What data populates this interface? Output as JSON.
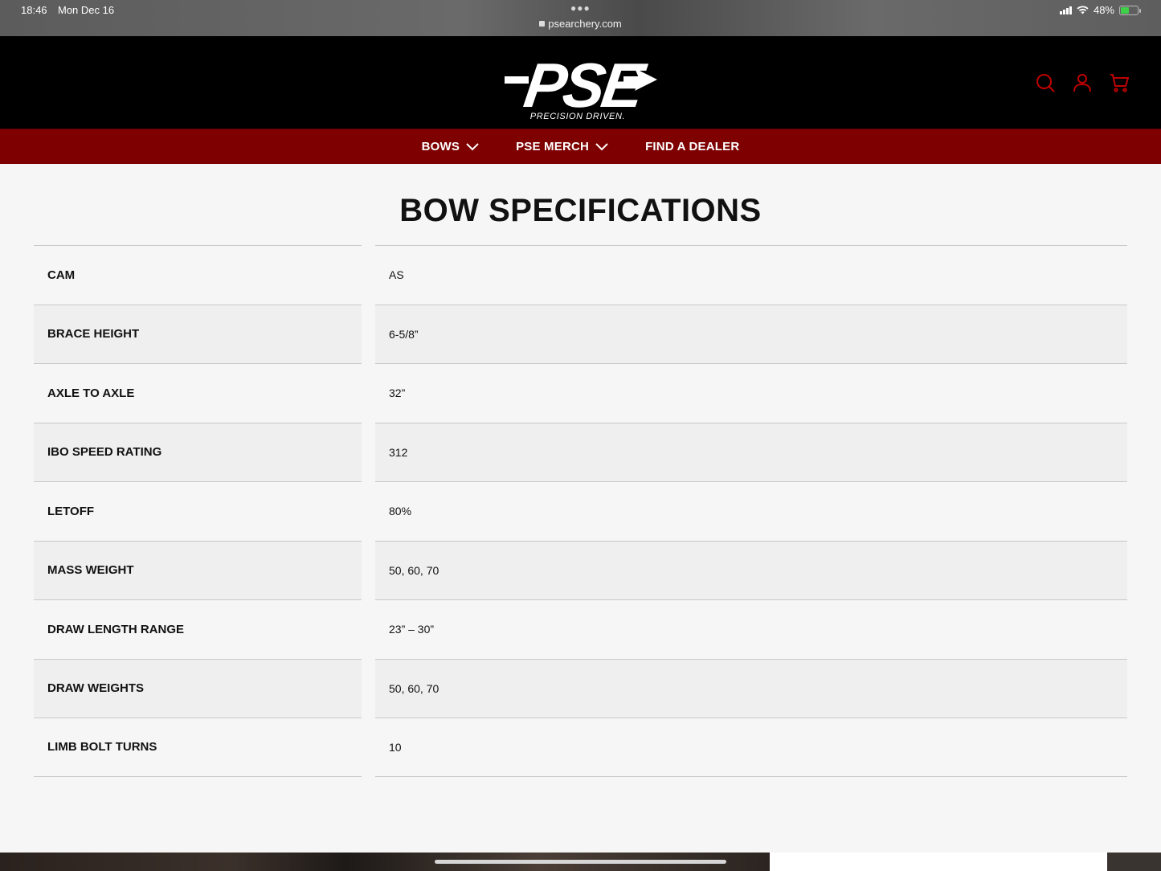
{
  "status_bar": {
    "time": "18:46",
    "date": "Mon Dec 16",
    "url": "psearchery.com",
    "battery": "48%"
  },
  "header": {
    "logo_text": "PSE",
    "logo_tagline": "PRECISION DRIVEN.",
    "icons": [
      "search-icon",
      "account-icon",
      "cart-icon"
    ],
    "accent_color": "#c00000"
  },
  "nav": {
    "items": [
      {
        "label": "BOWS"
      },
      {
        "label": "PSE MERCH"
      },
      {
        "label": "FIND A DEALER"
      }
    ],
    "background": "#7e0000"
  },
  "main": {
    "title": "BOW SPECIFICATIONS",
    "specs": [
      {
        "label": "CAM",
        "value": "AS"
      },
      {
        "label": "BRACE HEIGHT",
        "value": "6-5/8”"
      },
      {
        "label": "AXLE TO AXLE",
        "value": "32”"
      },
      {
        "label": "IBO SPEED RATING",
        "value": "312"
      },
      {
        "label": "LETOFF",
        "value": "80%"
      },
      {
        "label": "MASS WEIGHT",
        "value": "50, 60, 70"
      },
      {
        "label": "DRAW LENGTH RANGE",
        "value": "23” – 30”"
      },
      {
        "label": "DRAW WEIGHTS",
        "value": "50, 60, 70"
      },
      {
        "label": "LIMB BOLT TURNS",
        "value": "10"
      }
    ]
  }
}
